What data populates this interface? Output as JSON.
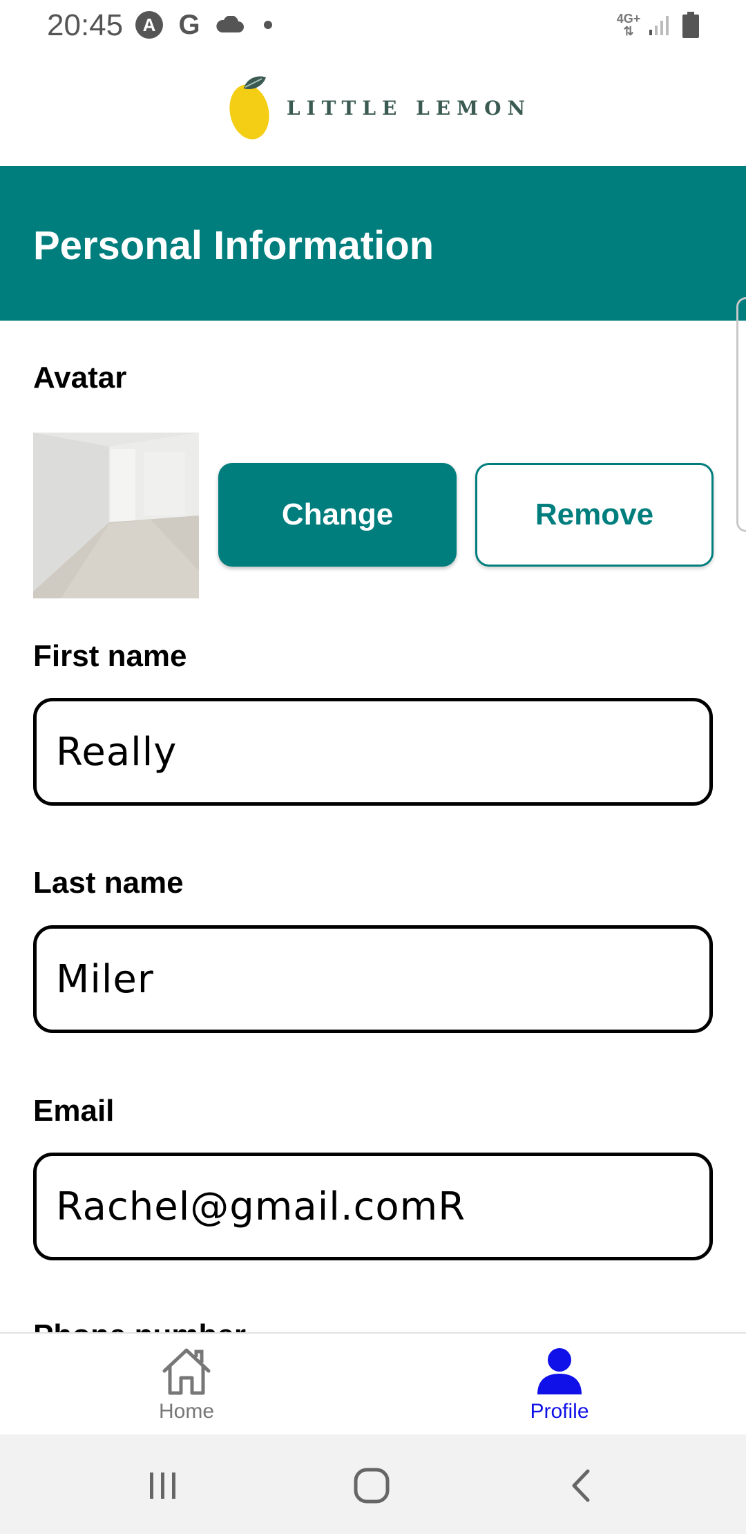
{
  "status_bar": {
    "time": "20:45",
    "app_icon_letter": "A",
    "google_letter": "G",
    "network": "4G+"
  },
  "header": {
    "logo_text": "LITTLE LEMON"
  },
  "banner": {
    "title": "Personal Information",
    "color": "#007d7d"
  },
  "avatar": {
    "label": "Avatar",
    "change_label": "Change",
    "remove_label": "Remove"
  },
  "form": {
    "first_name": {
      "label": "First name",
      "value": "Really"
    },
    "last_name": {
      "label": "Last name",
      "value": "Miler"
    },
    "email": {
      "label": "Email",
      "value": "Rachel@gmail.comR"
    },
    "phone": {
      "label": "Phone number"
    }
  },
  "bottom_nav": {
    "items": [
      {
        "label": "Home",
        "icon": "home-icon",
        "active": false
      },
      {
        "label": "Profile",
        "icon": "person-icon",
        "active": true
      }
    ],
    "active_color": "#1010e8",
    "inactive_color": "#777777"
  },
  "system_nav": {
    "icons": [
      "recents-icon",
      "home-circle-icon",
      "back-icon"
    ]
  }
}
